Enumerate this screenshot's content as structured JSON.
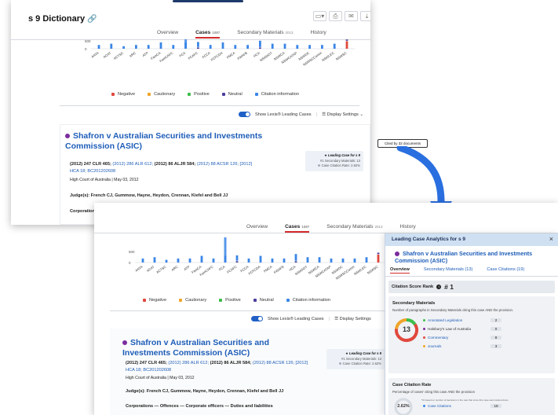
{
  "colors": {
    "negative": "#e0483d",
    "cautionary": "#f0a52a",
    "positive": "#3ebd4b",
    "neutral": "#4a3f9e",
    "citation": "#3a86e6",
    "link": "#1e5db8",
    "accent_tab": "#d42b2b"
  },
  "top": {
    "doc_title": "s 9 Dictionary",
    "clip_icon": "paperclip-icon",
    "tabs": [
      {
        "label": "Overview",
        "count": ""
      },
      {
        "label": "Cases",
        "count": "1087"
      },
      {
        "label": "Secondary Materials",
        "count": "2013"
      },
      {
        "label": "History",
        "count": ""
      }
    ],
    "active_tab": 1
  },
  "toolbar_icons": [
    "folder-icon",
    "print-icon",
    "email-icon",
    "download-icon"
  ],
  "toolbar_glyphs": [
    "▭▾",
    "⎙",
    "✉",
    "⤓"
  ],
  "chart_data": {
    "type": "bar",
    "categories": [
      "AATA",
      "ACAT",
      "ACTSC",
      "ARC",
      "ATP",
      "FamCA",
      "FamCAFC",
      "FCA",
      "FCAFC",
      "FCCA",
      "FCFCOA",
      "FMCA",
      "FWAFB",
      "HCA",
      "NSWADT",
      "NSWCA",
      "NSWCATAP",
      "NSWDC",
      "NSWSCComm",
      "NSWLEC",
      "NSWSC"
    ],
    "series": [
      {
        "name": "Negative",
        "values": [
          0,
          0,
          0,
          0,
          0,
          0,
          0,
          0,
          0,
          0,
          0,
          0,
          0,
          0,
          0,
          0,
          0,
          0,
          0,
          0,
          6
        ]
      },
      {
        "name": "Cautionary",
        "values": [
          0,
          0,
          0,
          0,
          0,
          0,
          0,
          0,
          0,
          0,
          0,
          0,
          0,
          0,
          0,
          0,
          0,
          0,
          0,
          0,
          0
        ]
      },
      {
        "name": "Positive",
        "values": [
          0,
          0,
          0,
          0,
          0,
          0,
          0,
          0,
          0,
          0,
          0,
          0,
          0,
          0,
          0,
          0,
          0,
          0,
          0,
          0,
          0
        ]
      },
      {
        "name": "Neutral",
        "values": [
          0,
          0,
          0,
          0,
          0,
          0,
          0,
          0,
          1,
          0,
          0,
          0,
          0,
          1,
          0,
          0,
          0,
          0,
          0,
          0,
          1
        ]
      },
      {
        "name": "Citation information",
        "values": [
          3,
          4,
          2,
          3,
          3,
          5,
          3,
          5,
          4,
          3,
          5,
          3,
          3,
          5,
          4,
          4,
          3,
          3,
          3,
          4,
          0
        ]
      }
    ],
    "y_ticks_bottom": [
      "500",
      "0"
    ],
    "highlight_index": 7,
    "legend_position": "bottom"
  },
  "legend": [
    {
      "label": "Negative",
      "key": "negative"
    },
    {
      "label": "Cautionary",
      "key": "cautionary"
    },
    {
      "label": "Positive",
      "key": "positive"
    },
    {
      "label": "Neutral",
      "key": "neutral"
    },
    {
      "label": "Citation information",
      "key": "citation"
    }
  ],
  "show_leading_label": "Show Lexis® Leading Cases",
  "display_settings_label": "Display Settings",
  "case": {
    "title": "Shafron v Australian Securities and Investments Commission (ASIC)",
    "citation_plain_1": "(2012) 247 CLR 465;",
    "citation_link_1": "(2012) 286 ALR 612;",
    "citation_plain_2": "(2012) 86 ALJR 584;",
    "citation_link_2": "(2012) 88 ACSR 126; [2012] HCA 18; BC201202608",
    "court_date": "High Court of Australia  |  May 03, 2012",
    "judges": "Judge(s): French CJ, Gummow, Hayne, Heydon, Crennan, Kiefel and Bell JJ",
    "catchwords": "Corporations — Offences — Corporate officers — Duties and liabilities",
    "leading_title": "Leading Case for s 9",
    "leading_sec": "#1 Secondary Materials: 13",
    "leading_rate": "Case Citation Rate: 2.62%"
  },
  "cited_by": "Cited by 32 documents",
  "side": {
    "title": "Leading Case Analytics for s 9",
    "close": "×",
    "case_title": "Shafron v Australian Securities and Investments Commission (ASIC)",
    "tabs": [
      "Overview",
      "Secondary Materials  (13)",
      "Case Citations  (19)"
    ],
    "rank_label": "Citation Score Rank",
    "rank_value": "# 1",
    "sec_title": "Secondary Materials",
    "sec_desc": "Number of paragraphs in Secondary Materials citing this case AND the provision.",
    "sec_total": "13",
    "sec_rows": [
      {
        "label": "Annotated Legislation",
        "value": "2",
        "color": "#3ebd4b"
      },
      {
        "label": "Halsbury's Law of Australia",
        "value": "0",
        "color": "#7b2c9e"
      },
      {
        "label": "Commentary",
        "value": "8",
        "color": "#e0483d"
      },
      {
        "label": "Journals",
        "value": "3",
        "color": "#f0a52a"
      }
    ],
    "rate_title": "Case Citation Rate",
    "rate_desc": "Percentage of cases' citing this case AND the provision",
    "rate_value": "2.62%",
    "rate_note": "*% based on number of decisions in the Law that since this case was handed down",
    "rate_row_label": "Case Citations",
    "rate_row_value": "19"
  }
}
